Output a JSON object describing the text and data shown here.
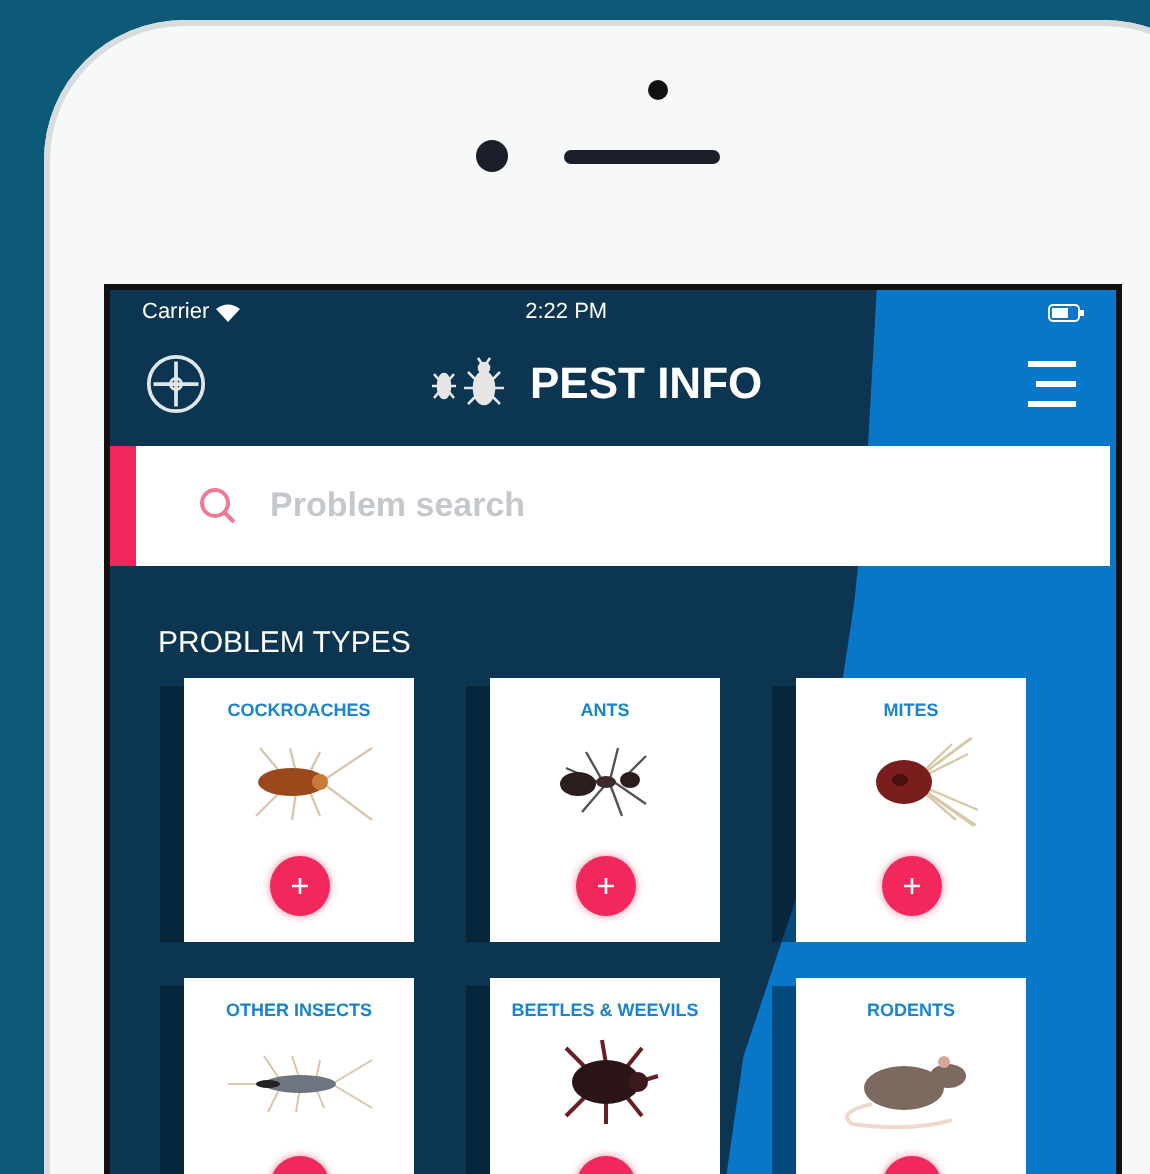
{
  "status_bar": {
    "carrier": "Carrier",
    "time": "2:22 PM"
  },
  "header": {
    "title": "PEST INFO"
  },
  "search": {
    "placeholder": "Problem search"
  },
  "section_title": "PROBLEM TYPES",
  "problem_types": [
    {
      "label": "COCKROACHES",
      "kind": "cockroach"
    },
    {
      "label": "ANTS",
      "kind": "ant"
    },
    {
      "label": "MITES",
      "kind": "mite"
    },
    {
      "label": "OTHER INSECTS",
      "kind": "silverfish"
    },
    {
      "label": "BEETLES & WEEVILS",
      "kind": "beetle"
    },
    {
      "label": "RODENTS",
      "kind": "rodent"
    }
  ]
}
